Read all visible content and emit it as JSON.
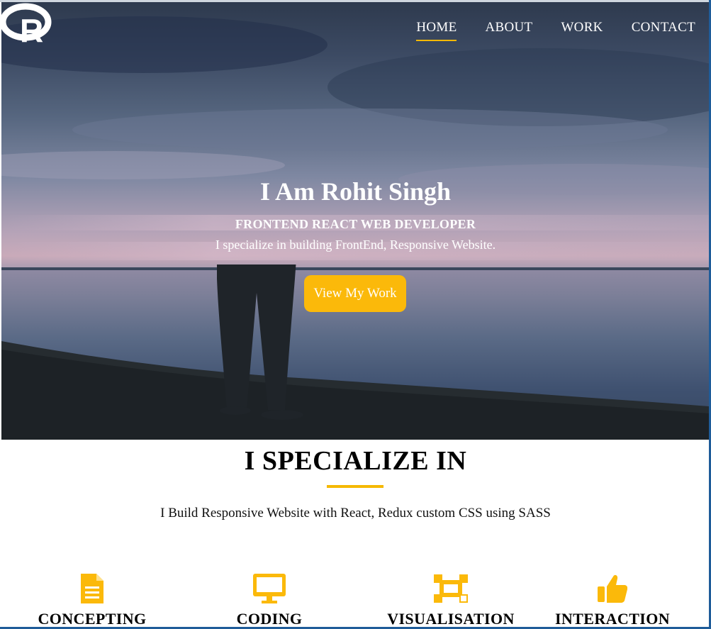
{
  "brand": {
    "logo_letter": "R"
  },
  "nav": {
    "items": [
      {
        "label": "HOME",
        "active": true
      },
      {
        "label": "ABOUT",
        "active": false
      },
      {
        "label": "WORK",
        "active": false
      },
      {
        "label": "CONTACT",
        "active": false
      }
    ]
  },
  "hero": {
    "title": "I Am Rohit Singh",
    "subtitle": "FRONTEND REACT WEB DEVELOPER",
    "description": "I specialize in building FrontEnd, Responsive Website.",
    "cta_label": "View My Work"
  },
  "specialize": {
    "title": "I SPECIALIZE IN",
    "description": "I Build Responsive Website with React, Redux custom CSS using SASS",
    "features": [
      {
        "label": "CONCEPTING",
        "icon": "document-icon"
      },
      {
        "label": "CODING",
        "icon": "monitor-icon"
      },
      {
        "label": "VISUALISATION",
        "icon": "vector-icon"
      },
      {
        "label": "INTERACTION",
        "icon": "thumbs-up-icon"
      }
    ]
  },
  "colors": {
    "accent": "#fbb90a",
    "text": "#000000",
    "hero_text": "#ffffff"
  }
}
